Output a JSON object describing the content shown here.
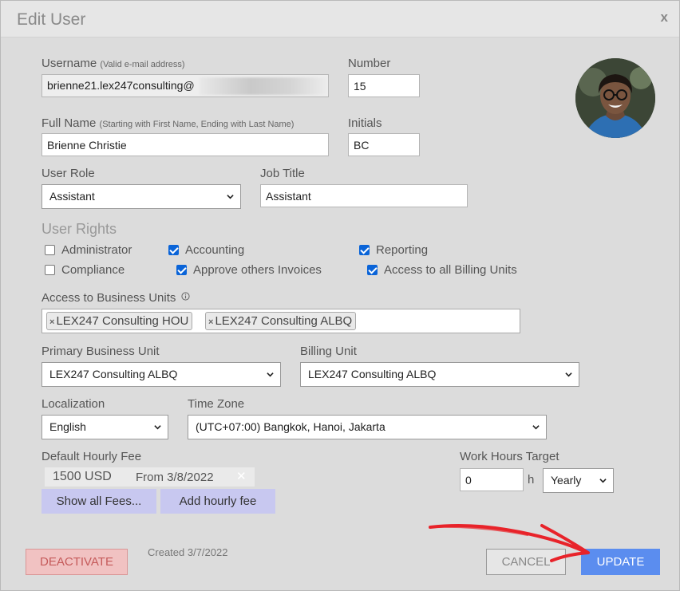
{
  "dialog": {
    "title": "Edit User",
    "close_label": "x"
  },
  "username": {
    "label": "Username",
    "hint": "(Valid e-mail address)",
    "value": "brienne21.lex247consulting@"
  },
  "number": {
    "label": "Number",
    "value": "15"
  },
  "full_name": {
    "label": "Full Name",
    "hint": "(Starting with First Name, Ending with Last Name)",
    "value": "Brienne Christie"
  },
  "initials": {
    "label": "Initials",
    "value": "BC"
  },
  "user_role": {
    "label": "User Role",
    "value": "Assistant"
  },
  "job_title": {
    "label": "Job Title",
    "value": "Assistant"
  },
  "user_rights": {
    "label": "User Rights",
    "items": [
      {
        "label": "Administrator",
        "checked": false
      },
      {
        "label": "Accounting",
        "checked": true
      },
      {
        "label": "Reporting",
        "checked": true
      },
      {
        "label": "Compliance",
        "checked": false
      },
      {
        "label": "Approve others Invoices",
        "checked": true
      },
      {
        "label": "Access to all Billing Units",
        "checked": true
      }
    ]
  },
  "business_units": {
    "label": "Access to Business Units",
    "info_icon": "info-icon",
    "tags": [
      "LEX247 Consulting HOU",
      "LEX247 Consulting ALBQ"
    ],
    "remove_glyph": "×"
  },
  "primary_business_unit": {
    "label": "Primary Business Unit",
    "value": "LEX247 Consulting ALBQ"
  },
  "billing_unit": {
    "label": "Billing Unit",
    "value": "LEX247 Consulting ALBQ"
  },
  "localization": {
    "label": "Localization",
    "value": "English"
  },
  "time_zone": {
    "label": "Time Zone",
    "value": "(UTC+07:00) Bangkok, Hanoi, Jakarta"
  },
  "hourly_fee": {
    "label": "Default Hourly Fee",
    "amount": "1500 USD",
    "from": "From 3/8/2022",
    "remove_glyph": "✕",
    "show_all_label": "Show all Fees...",
    "add_label": "Add hourly fee"
  },
  "work_hours": {
    "label": "Work Hours Target",
    "value": "0",
    "unit": "h",
    "period": "Yearly"
  },
  "footer": {
    "deactivate_label": "DEACTIVATE",
    "created": "Created 3/7/2022",
    "cancel_label": "CANCEL",
    "update_label": "UPDATE"
  },
  "colors": {
    "accent": "#5b8def",
    "checkbox": "#0a64d8",
    "danger": "#f1c2c2",
    "annotation": "#e8232a"
  }
}
